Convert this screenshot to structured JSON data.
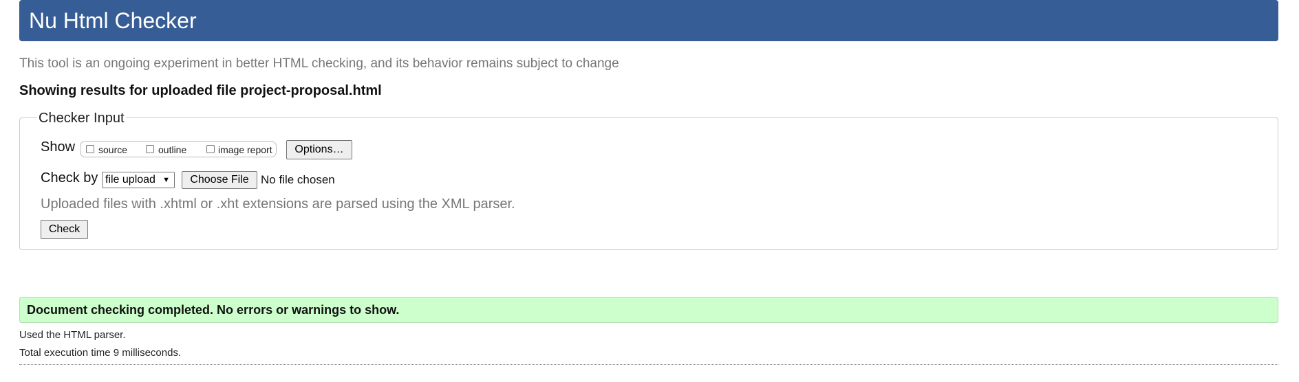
{
  "header": {
    "title": "Nu Html Checker"
  },
  "tagline": "This tool is an ongoing experiment in better HTML checking, and its behavior remains subject to change",
  "results_for": "Showing results for uploaded file project-proposal.html",
  "checker_input": {
    "legend": "Checker Input",
    "show_label": "Show",
    "show_options": [
      {
        "label": "source",
        "checked": false
      },
      {
        "label": "outline",
        "checked": false
      },
      {
        "label": "image report",
        "checked": false
      }
    ],
    "options_button": "Options…",
    "check_by_label": "Check by",
    "check_by_value": "file upload",
    "choose_file_button": "Choose File",
    "file_status": "No file chosen",
    "note": "Uploaded files with .xhtml or .xht extensions are parsed using the XML parser.",
    "check_button": "Check"
  },
  "result": {
    "message": "Document checking completed. No errors or warnings to show.",
    "color": "#ccffcc"
  },
  "stats": {
    "parser": "Used the HTML parser.",
    "execution_time": "Total execution time 9 milliseconds."
  },
  "colors": {
    "header_bg": "#365d96",
    "success_bg": "#ccffcc"
  }
}
